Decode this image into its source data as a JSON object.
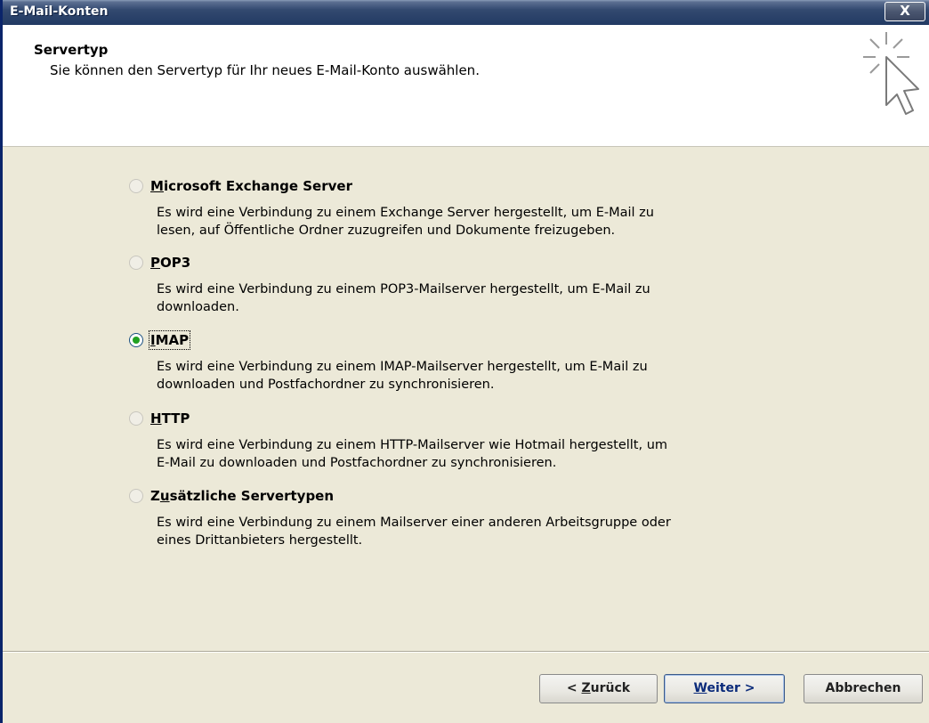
{
  "window": {
    "title": "E-Mail-Konten",
    "close_label": "X"
  },
  "header": {
    "title": "Servertyp",
    "subtitle": "Sie können den Servertyp für Ihr neues E-Mail-Konto auswählen."
  },
  "options": [
    {
      "label_pre": "",
      "label_ul": "M",
      "label_post": "icrosoft Exchange Server",
      "checked": false,
      "description": "Es wird eine Verbindung zu einem Exchange Server hergestellt, um E-Mail zu\nlesen, auf Öffentliche Ordner zuzugreifen und Dokumente freizugeben."
    },
    {
      "label_pre": "",
      "label_ul": "P",
      "label_post": "OP3",
      "checked": false,
      "description": "Es wird eine Verbindung zu einem POP3-Mailserver hergestellt, um E-Mail zu\ndownloaden."
    },
    {
      "label_pre": "",
      "label_ul": "I",
      "label_post": "MAP",
      "checked": true,
      "description": "Es wird eine Verbindung zu einem IMAP-Mailserver hergestellt, um E-Mail zu\ndownloaden und Postfachordner zu synchronisieren."
    },
    {
      "label_pre": "",
      "label_ul": "H",
      "label_post": "TTP",
      "checked": false,
      "description": "Es wird eine Verbindung zu einem HTTP-Mailserver wie Hotmail hergestellt, um\nE-Mail zu downloaden und Postfachordner zu synchronisieren."
    },
    {
      "label_pre": "Z",
      "label_ul": "u",
      "label_post": "sätzliche Servertypen",
      "checked": false,
      "description": "Es wird eine Verbindung zu einem Mailserver einer anderen Arbeitsgruppe oder\neines Drittanbieters hergestellt."
    }
  ],
  "buttons": {
    "back_pre": "< ",
    "back_ul": "Z",
    "back_post": "urück",
    "next_ul": "W",
    "next_post": "eiter >",
    "cancel": "Abbrechen"
  },
  "colors": {
    "titlebar": "#223A63",
    "dialog_bg": "#ECE9D8",
    "radio_selected": "#21A121"
  },
  "icons": {
    "wizard": "cursor-sparkle-icon",
    "close": "close-icon"
  }
}
